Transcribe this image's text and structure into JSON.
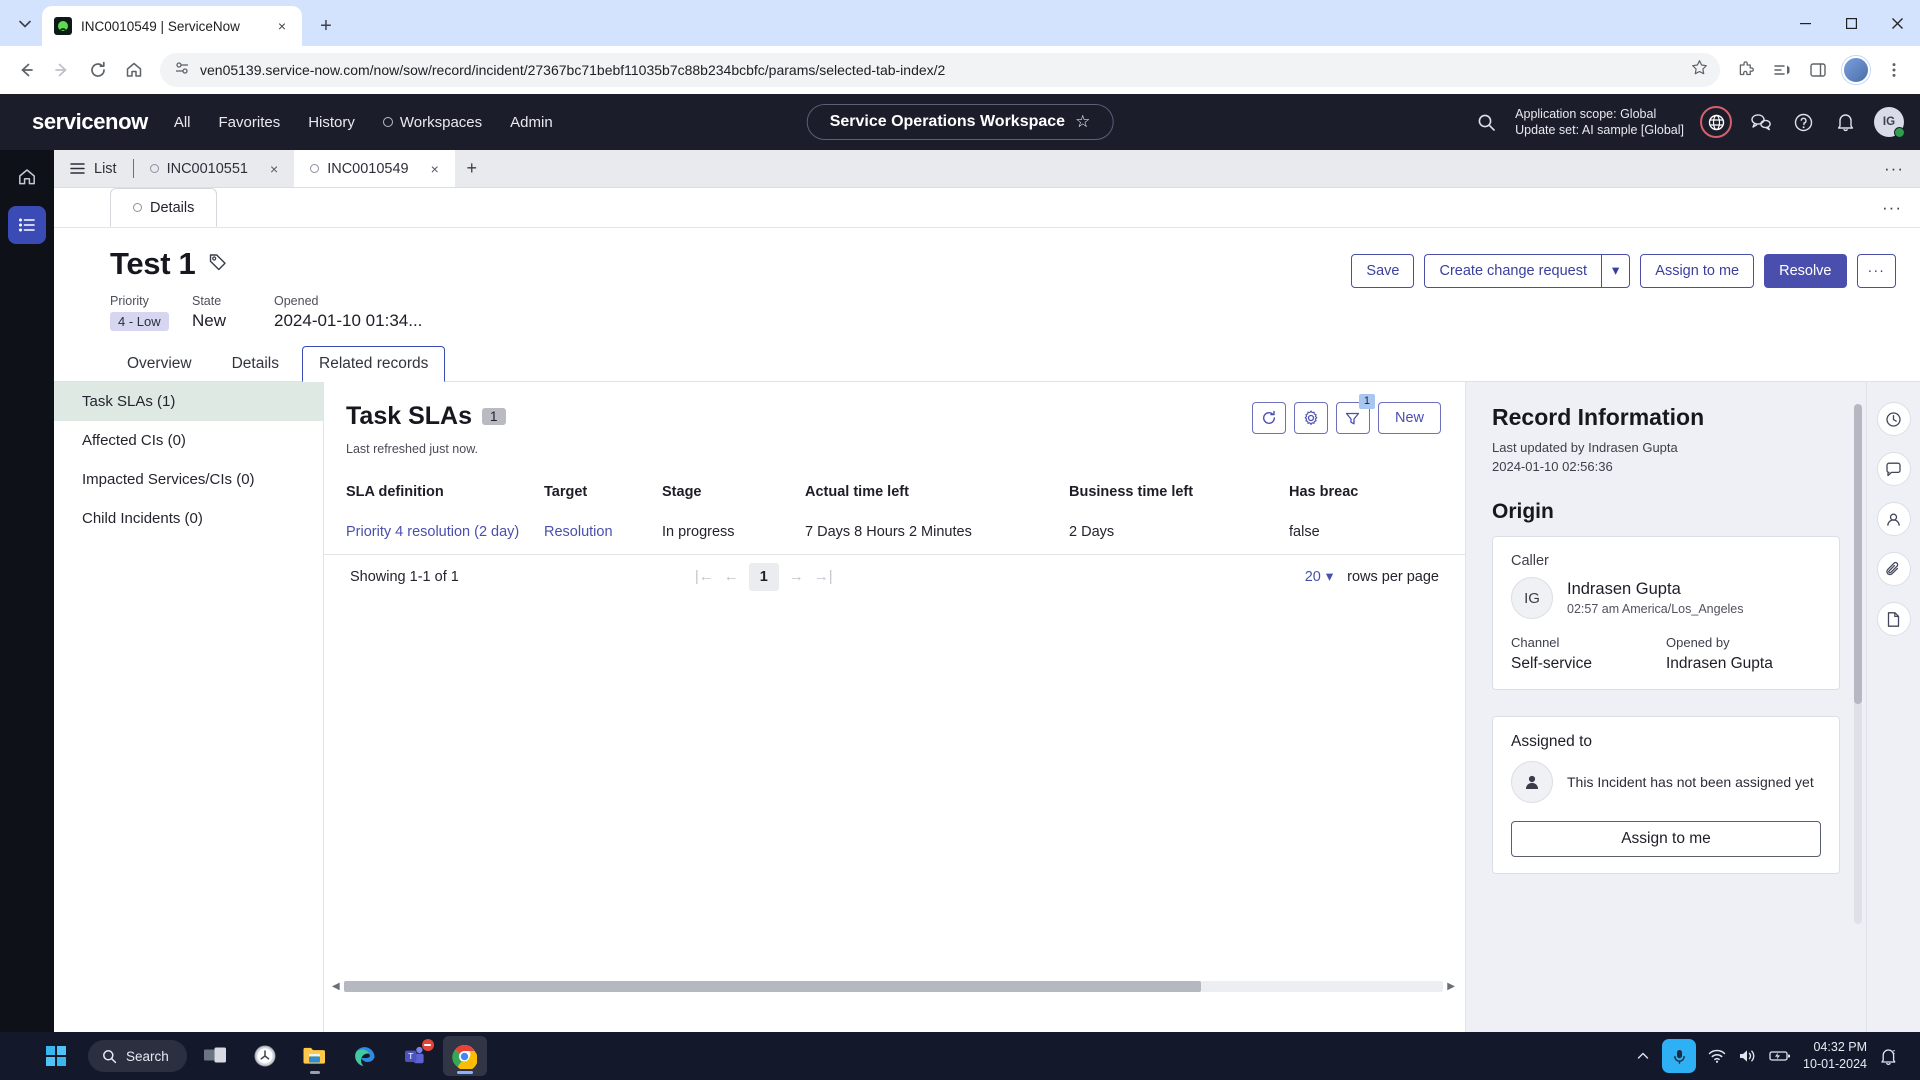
{
  "browser": {
    "tab": {
      "title": "INC0010549 | ServiceNow",
      "favicon": "servicenow-favicon",
      "close": "×"
    },
    "new_tab_label": "+",
    "url": "ven05139.service-now.com/now/sow/record/incident/27367bc71bebf11035b7c88b234bcbfc/params/selected-tab-index/2",
    "window_controls": {
      "minimize": "—",
      "maximize": "▢",
      "close": "✕"
    },
    "nav": {
      "back": "←",
      "forward": "→",
      "reload": "⟳",
      "home": "⌂"
    }
  },
  "sn_header": {
    "logo": "servicenow",
    "nav_items": [
      {
        "label": "All"
      },
      {
        "label": "Favorites"
      },
      {
        "label": "History"
      },
      {
        "label": "Workspaces"
      },
      {
        "label": "Admin"
      }
    ],
    "workspace_title": "Service Operations Workspace",
    "workspace_star": "☆",
    "application_scope": "Application scope: Global",
    "update_set": "Update set: AI sample [Global]",
    "avatar_initials": "IG"
  },
  "record_tabs": {
    "list_label": "List",
    "tabs": [
      {
        "label": "INC0010551",
        "active": false,
        "close": "×"
      },
      {
        "label": "INC0010549",
        "active": true,
        "close": "×"
      }
    ],
    "add_label": "+",
    "overflow": "···"
  },
  "details_bar": {
    "label": "Details",
    "overflow": "···"
  },
  "record": {
    "title": "Test 1",
    "meta": [
      {
        "label": "Priority",
        "value": "4 - Low",
        "badge": true
      },
      {
        "label": "State",
        "value": "New",
        "badge": false
      },
      {
        "label": "Opened",
        "value": "2024-01-10 01:34...",
        "badge": false
      }
    ],
    "actions": {
      "save": "Save",
      "create_change_request": "Create change request",
      "caret": "▾",
      "assign_to_me": "Assign to me",
      "resolve": "Resolve",
      "more": "···"
    }
  },
  "section_tabs": [
    {
      "label": "Overview",
      "active": false
    },
    {
      "label": "Details",
      "active": false
    },
    {
      "label": "Related records",
      "active": true
    }
  ],
  "related_list": [
    {
      "label": "Task SLAs (1)",
      "active": true
    },
    {
      "label": "Affected CIs (0)",
      "active": false
    },
    {
      "label": "Impacted Services/CIs (0)",
      "active": false
    },
    {
      "label": "Child Incidents (0)",
      "active": false
    }
  ],
  "table_panel": {
    "title": "Task SLAs",
    "count": "1",
    "refreshed": "Last refreshed just now.",
    "tools": {
      "refresh": "refresh-icon",
      "settings": "gear-icon",
      "filter": "filter-icon",
      "filter_badge": "1",
      "new_label": "New"
    },
    "columns": [
      "SLA definition",
      "Target",
      "Stage",
      "Actual time left",
      "Business time left",
      "Has breac"
    ],
    "rows": [
      {
        "sla_definition": "Priority 4 resolution (2 day)",
        "target": "Resolution",
        "stage": "In progress",
        "actual_time_left": "7 Days 8 Hours 2 Minutes",
        "business_time_left": "2 Days",
        "has_breached": "false"
      }
    ],
    "pager": {
      "showing": "Showing 1-1 of 1",
      "first": "|←",
      "prev": "←",
      "page": "1",
      "next": "→",
      "last": "→|",
      "rows_per_page_value": "20",
      "rows_per_page_caret": "▾",
      "rows_per_page_label": "rows per page"
    }
  },
  "info_panel": {
    "title": "Record Information",
    "last_updated_by": "Last updated by Indrasen Gupta",
    "last_updated_at": "2024-01-10 02:56:36",
    "origin_heading": "Origin",
    "caller_label": "Caller",
    "caller_initials": "IG",
    "caller_name": "Indrasen Gupta",
    "caller_timezone": "02:57 am America/Los_Angeles",
    "channel_label": "Channel",
    "channel_value": "Self-service",
    "opened_by_label": "Opened by",
    "opened_by_value": "Indrasen Gupta",
    "assigned_to_label": "Assigned to",
    "assigned_to_message": "This Incident has not been assigned yet",
    "assign_button": "Assign to me"
  },
  "taskbar": {
    "search_placeholder": "Search",
    "clock_time": "04:32 PM",
    "clock_date": "10-01-2024",
    "apps": [
      {
        "name": "task-view-icon"
      },
      {
        "name": "clock-app-icon"
      },
      {
        "name": "file-explorer-icon"
      },
      {
        "name": "edge-browser-icon"
      },
      {
        "name": "teams-icon"
      },
      {
        "name": "chrome-browser-icon"
      }
    ]
  }
}
